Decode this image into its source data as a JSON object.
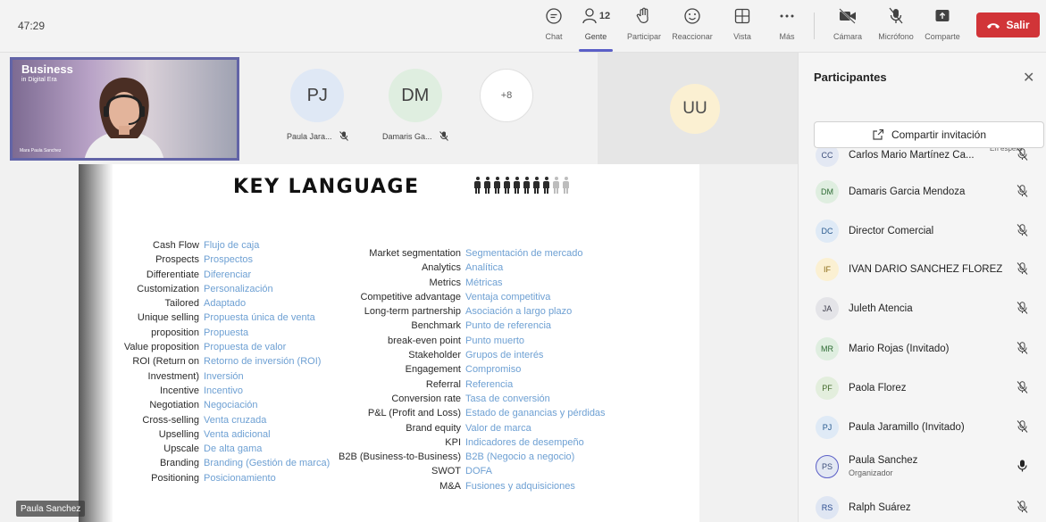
{
  "timer": "47:29",
  "toolbar": {
    "chat": "Chat",
    "people": "Gente",
    "people_count": "12",
    "raise": "Participar",
    "react": "Reaccionar",
    "view": "Vista",
    "more": "Más",
    "camera": "Cámara",
    "mic": "Micrófono",
    "share": "Comparte",
    "leave": "Salir"
  },
  "stage": {
    "self_video": {
      "brand_title": "Business",
      "brand_subtitle": "in Digital Era",
      "caption": "Mara Paula Sanchez"
    },
    "tiles": [
      {
        "initials": "PJ",
        "name": "Paula Jara...",
        "color": "#dfe8f5"
      },
      {
        "initials": "DM",
        "name": "Damaris Ga...",
        "color": "#dfeee0"
      }
    ],
    "more_count": "+8",
    "uu_tile": {
      "initials": "UU",
      "color": "#fbf0d2"
    },
    "name_label": "Paula Sanchez"
  },
  "slide": {
    "title": "KEY LANGUAGE",
    "figures_dark": 8,
    "figures_light": 2,
    "left_terms": [
      {
        "en": "Cash Flow",
        "es": "Flujo de caja"
      },
      {
        "en": "Prospects",
        "es": "Prospectos"
      },
      {
        "en": "Differentiate",
        "es": "Diferenciar"
      },
      {
        "en": "Customization",
        "es": "Personalización"
      },
      {
        "en": "Tailored",
        "es": "Adaptado"
      },
      {
        "en": "Unique selling",
        "es": "Propuesta única de venta"
      },
      {
        "en": "proposition",
        "es": "Propuesta"
      },
      {
        "en": "Value proposition",
        "es": "Propuesta de valor"
      },
      {
        "en": "ROI (Return on",
        "es": "Retorno de inversión (ROI)"
      },
      {
        "en": "Investment)",
        "es": "Inversión"
      },
      {
        "en": "Incentive",
        "es": "Incentivo"
      },
      {
        "en": "Negotiation",
        "es": "Negociación"
      },
      {
        "en": "Cross-selling",
        "es": "Venta cruzada"
      },
      {
        "en": "Upselling",
        "es": "Venta adicional"
      },
      {
        "en": "Upscale",
        "es": "De alta gama"
      },
      {
        "en": "Branding",
        "es": "Branding (Gestión de marca)"
      },
      {
        "en": "Positioning",
        "es": "Posicionamiento"
      }
    ],
    "right_terms": [
      {
        "en": "Market segmentation",
        "es": "Segmentación de mercado"
      },
      {
        "en": "Analytics",
        "es": "Analítica"
      },
      {
        "en": "Metrics",
        "es": "Métricas"
      },
      {
        "en": "Competitive advantage",
        "es": "Ventaja competitiva"
      },
      {
        "en": "Long-term partnership",
        "es": "Asociación a largo plazo"
      },
      {
        "en": "Benchmark",
        "es": "Punto de referencia"
      },
      {
        "en": "break-even point",
        "es": "Punto muerto"
      },
      {
        "en": "Stakeholder",
        "es": "Grupos de interés"
      },
      {
        "en": "Engagement",
        "es": "Compromiso"
      },
      {
        "en": "Referral",
        "es": "Referencia"
      },
      {
        "en": "Conversion rate",
        "es": "Tasa de conversión"
      },
      {
        "en": "P&L (Profit and Loss)",
        "es": "Estado de ganancias y pérdidas"
      },
      {
        "en": "Brand equity",
        "es": "Valor de marca"
      },
      {
        "en": "KPI",
        "es": "Indicadores de desempeño"
      },
      {
        "en": "B2B (Business-to-Business)",
        "es": "B2B (Negocio a negocio)"
      },
      {
        "en": "SWOT",
        "es": "DOFA"
      },
      {
        "en": "M&A",
        "es": "Fusiones y adquisiciones"
      }
    ]
  },
  "panel": {
    "title": "Participantes",
    "invite_label": "Compartir invitación",
    "participants": [
      {
        "initials": "CC",
        "name": "Carlos Mario Martínez Ca...",
        "status": "En espera",
        "color": "#e3e8f3",
        "text_color": "#3d4e7a",
        "mic": "muted"
      },
      {
        "initials": "DM",
        "name": "Damaris Garcia Mendoza",
        "color": "#dfeee0",
        "text_color": "#2e6b34",
        "mic": "muted"
      },
      {
        "initials": "DC",
        "name": "Director Comercial",
        "color": "#dfeaf6",
        "text_color": "#2a5b8f",
        "mic": "muted"
      },
      {
        "initials": "IF",
        "name": "IVAN DARIO SANCHEZ FLOREZ",
        "color": "#fbf0d2",
        "text_color": "#8a6a15",
        "mic": "muted"
      },
      {
        "initials": "JA",
        "name": "Juleth Atencia",
        "color": "#e4e4e8",
        "text_color": "#3c3c4a",
        "mic": "muted"
      },
      {
        "initials": "MR",
        "name": "Mario Rojas (Invitado)",
        "color": "#dfeee0",
        "text_color": "#2e6b34",
        "mic": "muted"
      },
      {
        "initials": "PF",
        "name": "Paola Florez",
        "color": "#e3eedd",
        "text_color": "#456b2e",
        "mic": "muted"
      },
      {
        "initials": "PJ",
        "name": "Paula Jaramillo (Invitado)",
        "color": "#dfeaf6",
        "text_color": "#2a5b8f",
        "mic": "muted"
      },
      {
        "initials": "PS",
        "name": "Paula Sanchez",
        "role": "Organizador",
        "color": "#e3e8f3",
        "text_color": "#3d4e7a",
        "mic": "on"
      },
      {
        "initials": "RS",
        "name": "Ralph Suárez",
        "color": "#dfe6f3",
        "text_color": "#2a4b8f",
        "mic": "muted"
      }
    ]
  },
  "colors": {
    "accent": "#5b5fc7",
    "leave": "#d13438",
    "translation_text": "#6ea0d3"
  }
}
